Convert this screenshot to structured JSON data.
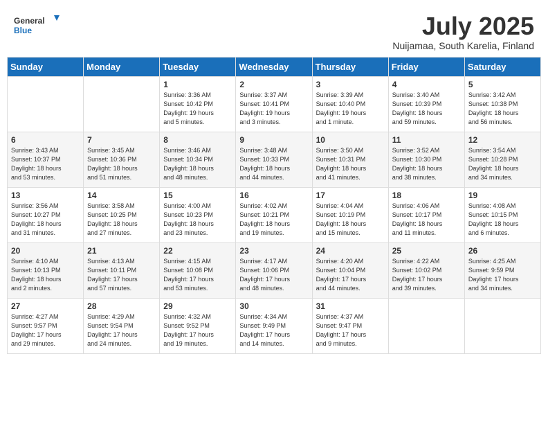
{
  "header": {
    "logo_general": "General",
    "logo_blue": "Blue",
    "month_year": "July 2025",
    "location": "Nuijamaa, South Karelia, Finland"
  },
  "weekdays": [
    "Sunday",
    "Monday",
    "Tuesday",
    "Wednesday",
    "Thursday",
    "Friday",
    "Saturday"
  ],
  "weeks": [
    [
      {
        "day": "",
        "info": ""
      },
      {
        "day": "",
        "info": ""
      },
      {
        "day": "1",
        "info": "Sunrise: 3:36 AM\nSunset: 10:42 PM\nDaylight: 19 hours\nand 5 minutes."
      },
      {
        "day": "2",
        "info": "Sunrise: 3:37 AM\nSunset: 10:41 PM\nDaylight: 19 hours\nand 3 minutes."
      },
      {
        "day": "3",
        "info": "Sunrise: 3:39 AM\nSunset: 10:40 PM\nDaylight: 19 hours\nand 1 minute."
      },
      {
        "day": "4",
        "info": "Sunrise: 3:40 AM\nSunset: 10:39 PM\nDaylight: 18 hours\nand 59 minutes."
      },
      {
        "day": "5",
        "info": "Sunrise: 3:42 AM\nSunset: 10:38 PM\nDaylight: 18 hours\nand 56 minutes."
      }
    ],
    [
      {
        "day": "6",
        "info": "Sunrise: 3:43 AM\nSunset: 10:37 PM\nDaylight: 18 hours\nand 53 minutes."
      },
      {
        "day": "7",
        "info": "Sunrise: 3:45 AM\nSunset: 10:36 PM\nDaylight: 18 hours\nand 51 minutes."
      },
      {
        "day": "8",
        "info": "Sunrise: 3:46 AM\nSunset: 10:34 PM\nDaylight: 18 hours\nand 48 minutes."
      },
      {
        "day": "9",
        "info": "Sunrise: 3:48 AM\nSunset: 10:33 PM\nDaylight: 18 hours\nand 44 minutes."
      },
      {
        "day": "10",
        "info": "Sunrise: 3:50 AM\nSunset: 10:31 PM\nDaylight: 18 hours\nand 41 minutes."
      },
      {
        "day": "11",
        "info": "Sunrise: 3:52 AM\nSunset: 10:30 PM\nDaylight: 18 hours\nand 38 minutes."
      },
      {
        "day": "12",
        "info": "Sunrise: 3:54 AM\nSunset: 10:28 PM\nDaylight: 18 hours\nand 34 minutes."
      }
    ],
    [
      {
        "day": "13",
        "info": "Sunrise: 3:56 AM\nSunset: 10:27 PM\nDaylight: 18 hours\nand 31 minutes."
      },
      {
        "day": "14",
        "info": "Sunrise: 3:58 AM\nSunset: 10:25 PM\nDaylight: 18 hours\nand 27 minutes."
      },
      {
        "day": "15",
        "info": "Sunrise: 4:00 AM\nSunset: 10:23 PM\nDaylight: 18 hours\nand 23 minutes."
      },
      {
        "day": "16",
        "info": "Sunrise: 4:02 AM\nSunset: 10:21 PM\nDaylight: 18 hours\nand 19 minutes."
      },
      {
        "day": "17",
        "info": "Sunrise: 4:04 AM\nSunset: 10:19 PM\nDaylight: 18 hours\nand 15 minutes."
      },
      {
        "day": "18",
        "info": "Sunrise: 4:06 AM\nSunset: 10:17 PM\nDaylight: 18 hours\nand 11 minutes."
      },
      {
        "day": "19",
        "info": "Sunrise: 4:08 AM\nSunset: 10:15 PM\nDaylight: 18 hours\nand 6 minutes."
      }
    ],
    [
      {
        "day": "20",
        "info": "Sunrise: 4:10 AM\nSunset: 10:13 PM\nDaylight: 18 hours\nand 2 minutes."
      },
      {
        "day": "21",
        "info": "Sunrise: 4:13 AM\nSunset: 10:11 PM\nDaylight: 17 hours\nand 57 minutes."
      },
      {
        "day": "22",
        "info": "Sunrise: 4:15 AM\nSunset: 10:08 PM\nDaylight: 17 hours\nand 53 minutes."
      },
      {
        "day": "23",
        "info": "Sunrise: 4:17 AM\nSunset: 10:06 PM\nDaylight: 17 hours\nand 48 minutes."
      },
      {
        "day": "24",
        "info": "Sunrise: 4:20 AM\nSunset: 10:04 PM\nDaylight: 17 hours\nand 44 minutes."
      },
      {
        "day": "25",
        "info": "Sunrise: 4:22 AM\nSunset: 10:02 PM\nDaylight: 17 hours\nand 39 minutes."
      },
      {
        "day": "26",
        "info": "Sunrise: 4:25 AM\nSunset: 9:59 PM\nDaylight: 17 hours\nand 34 minutes."
      }
    ],
    [
      {
        "day": "27",
        "info": "Sunrise: 4:27 AM\nSunset: 9:57 PM\nDaylight: 17 hours\nand 29 minutes."
      },
      {
        "day": "28",
        "info": "Sunrise: 4:29 AM\nSunset: 9:54 PM\nDaylight: 17 hours\nand 24 minutes."
      },
      {
        "day": "29",
        "info": "Sunrise: 4:32 AM\nSunset: 9:52 PM\nDaylight: 17 hours\nand 19 minutes."
      },
      {
        "day": "30",
        "info": "Sunrise: 4:34 AM\nSunset: 9:49 PM\nDaylight: 17 hours\nand 14 minutes."
      },
      {
        "day": "31",
        "info": "Sunrise: 4:37 AM\nSunset: 9:47 PM\nDaylight: 17 hours\nand 9 minutes."
      },
      {
        "day": "",
        "info": ""
      },
      {
        "day": "",
        "info": ""
      }
    ]
  ]
}
